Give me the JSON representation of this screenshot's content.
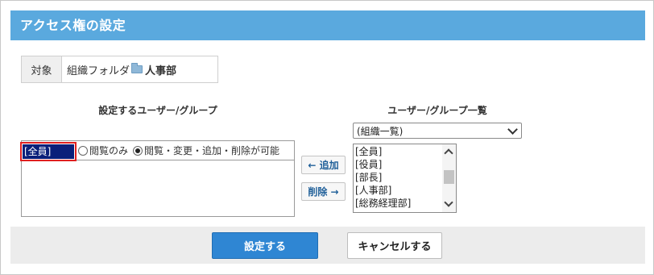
{
  "header": {
    "title": "アクセス権の設定"
  },
  "target": {
    "label": "対象",
    "path_prefix": "組織フォルダ",
    "folder_icon": "folder-icon",
    "folder_name": "人事部"
  },
  "left": {
    "title": "設定するユーザー/グループ",
    "selected_member": "[全員]",
    "radio_view_only": "閲覧のみ",
    "radio_full": "閲覧・変更・追加・削除が可能",
    "radio_selected": "full"
  },
  "buttons": {
    "add": "← 追加",
    "remove": "削除 →",
    "submit": "設定する",
    "cancel": "キャンセルする"
  },
  "right": {
    "title": "ユーザー/グループ一覧",
    "dropdown_value": "(組織一覧)",
    "items": [
      "[全員]",
      "[役員]",
      "[部長]",
      "[人事部]",
      "[総務経理部]"
    ]
  },
  "colors": {
    "header_bg": "#5aa9de",
    "selection_bg": "#0a1f7a",
    "highlight_border": "#e02020",
    "primary_button": "#2f86d3"
  }
}
